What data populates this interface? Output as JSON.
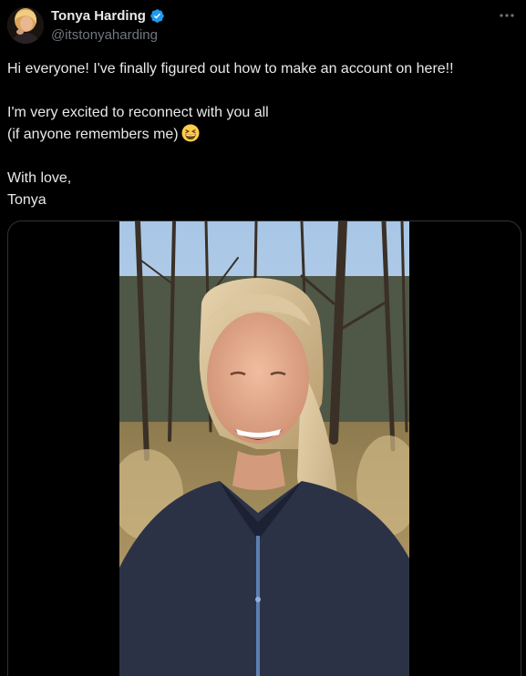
{
  "author": {
    "display_name": "Tonya Harding",
    "handle": "@itstonyaharding",
    "verified": true,
    "accent_color": "#1d9bf0"
  },
  "tweet": {
    "lines": [
      "Hi everyone! I've finally figured out how to make an account on here!!",
      "I'm very excited to reconnect with you all",
      "(if anyone remembers me)",
      "With love,",
      "Tonya"
    ],
    "emoji": "grinning-squinting-face-emoji"
  },
  "icons": {
    "verified": "verified-badge-icon",
    "more": "more-options-icon"
  },
  "colors": {
    "background": "#000000",
    "text_primary": "#e7e9ea",
    "text_secondary": "#71767b",
    "border": "#2f3336"
  }
}
